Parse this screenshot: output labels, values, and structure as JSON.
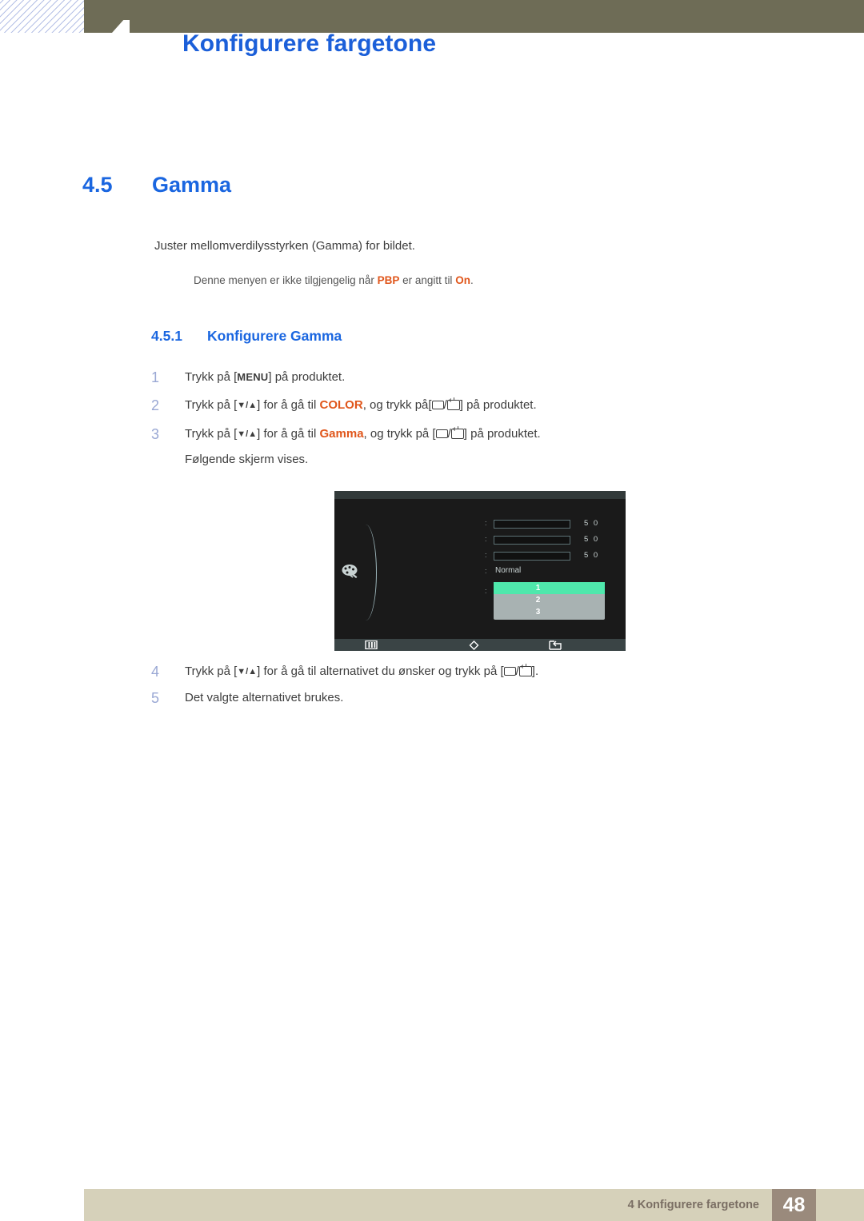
{
  "header": {
    "title": "Konfigurere fargetone"
  },
  "section": {
    "number": "4.5",
    "title": "Gamma",
    "intro": "Juster mellomverdilysstyrken (Gamma) for bildet.",
    "note_prefix": "Denne menyen er ikke tilgjengelig når ",
    "note_highlight_1": "PBP",
    "note_middle": " er angitt til ",
    "note_highlight_2": "On",
    "note_suffix": "."
  },
  "subsection": {
    "number": "4.5.1",
    "title": "Konfigurere Gamma"
  },
  "steps_before": [
    {
      "n": "1",
      "pre": "Trykk på [",
      "key": "MENU",
      "post": "] på produktet."
    },
    {
      "n": "2",
      "pre": "Trykk på [",
      "arrows": "▼/▲",
      "mid": "] for å gå til ",
      "target": "COLOR",
      "mid2": ", og trykk på[",
      "sep": "/",
      "post": "] på produktet."
    },
    {
      "n": "3",
      "pre": "Trykk på [",
      "arrows": "▼/▲",
      "mid": "] for å gå til ",
      "target": "Gamma",
      "mid2": ", og trykk på [",
      "sep": "/",
      "post": "] på produktet.",
      "sub": "Følgende skjerm vises."
    }
  ],
  "steps_after": [
    {
      "n": "4",
      "pre": "Trykk på [",
      "arrows": "▼/▲",
      "mid": "] for å gå til alternativet du ønsker og trykk på [",
      "sep": "/",
      "post": "]."
    },
    {
      "n": "5",
      "text": "Det valgte alternativet brukes."
    }
  ],
  "osd": {
    "icon": "palette-icon",
    "rows": [
      {
        "type": "slider",
        "colon": ":",
        "fill_percent": 50,
        "value": "5 0"
      },
      {
        "type": "slider",
        "colon": ":",
        "fill_percent": 50,
        "value": "5 0"
      },
      {
        "type": "slider",
        "colon": ":",
        "fill_percent": 50,
        "value": "5 0"
      },
      {
        "type": "text",
        "colon": ":",
        "value": "Normal"
      }
    ],
    "list": {
      "colon": ":",
      "items": [
        {
          "label": "1",
          "selected": true
        },
        {
          "label": "2",
          "selected": false
        },
        {
          "label": "3",
          "selected": false
        }
      ]
    },
    "bottom_icons": [
      "menu-bars-icon",
      "diamond-icon",
      "return-icon"
    ],
    "colors": {
      "background": "#1a1a1a",
      "highlight": "#4fe8ac",
      "list_background": "#a8b2b2",
      "slider_fill": "#a8b6b8"
    }
  },
  "footer": {
    "text": "4 Konfigurere fargetone",
    "page": "48"
  }
}
